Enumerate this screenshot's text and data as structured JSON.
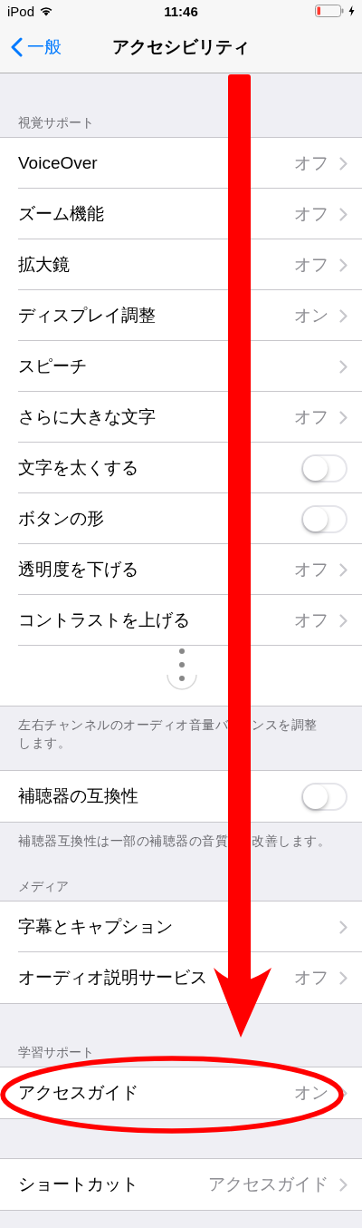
{
  "status_bar": {
    "carrier": "iPod",
    "time": "11:46"
  },
  "nav": {
    "back": "一般",
    "title": "アクセシビリティ"
  },
  "sections": [
    {
      "header": "視覚サポート",
      "rows": [
        {
          "kind": "link",
          "label": "VoiceOver",
          "value": "オフ"
        },
        {
          "kind": "link",
          "label": "ズーム機能",
          "value": "オフ"
        },
        {
          "kind": "link",
          "label": "拡大鏡",
          "value": "オフ"
        },
        {
          "kind": "link",
          "label": "ディスプレイ調整",
          "value": "オン"
        },
        {
          "kind": "link",
          "label": "スピーチ"
        },
        {
          "kind": "link",
          "label": "さらに大きな文字",
          "value": "オフ"
        },
        {
          "kind": "toggle",
          "label": "文字を太くする",
          "on": false
        },
        {
          "kind": "toggle",
          "label": "ボタンの形",
          "on": false
        },
        {
          "kind": "link",
          "label": "透明度を下げる",
          "value": "オフ"
        },
        {
          "kind": "link",
          "label": "コントラストを上げる",
          "value": "オフ"
        },
        {
          "kind": "elision"
        }
      ],
      "footer_lines": [
        {
          "segments": [
            "左右チャンネルのオーディオ音量バ",
            "ンスを調整"
          ]
        },
        {
          "segments": [
            "します。"
          ]
        }
      ]
    },
    {
      "rows": [
        {
          "kind": "toggle",
          "label": "補聴器の互換性",
          "on": false
        }
      ],
      "footer_lines": [
        {
          "segments": [
            "補聴器互換性は一部の補聴器の音質",
            "改善します。"
          ]
        }
      ]
    },
    {
      "header": "メディア",
      "rows": [
        {
          "kind": "link",
          "label": "字幕とキャプション"
        },
        {
          "kind": "link",
          "label": "オーディオ説明サービス",
          "value": "オフ"
        }
      ]
    },
    {
      "header": "学習サポート",
      "rows": [
        {
          "kind": "link",
          "label": "アクセスガイド",
          "value": "オン"
        }
      ]
    },
    {
      "rows": [
        {
          "kind": "link",
          "label": "ショートカット",
          "value": "アクセスガイド"
        }
      ]
    }
  ],
  "annotations": [
    {
      "kind": "arrow"
    },
    {
      "kind": "ellipse"
    }
  ]
}
